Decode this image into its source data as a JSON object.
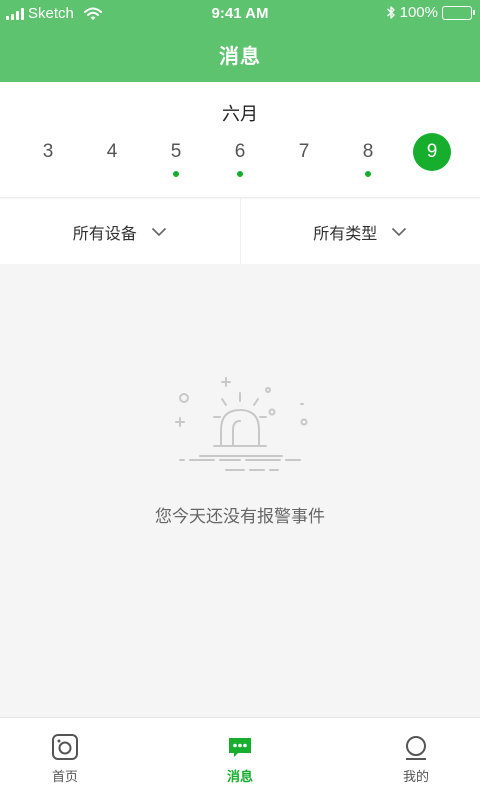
{
  "status_bar": {
    "carrier": "Sketch",
    "time": "9:41 AM",
    "battery": "100%"
  },
  "header": {
    "title": "消息"
  },
  "calendar": {
    "month": "六月",
    "days": [
      "3",
      "4",
      "5",
      "6",
      "7",
      "8",
      "9"
    ],
    "selected_day": "9",
    "days_with_alerts": [
      "5",
      "6",
      "8"
    ]
  },
  "filters": {
    "device": "所有设备",
    "type": "所有类型"
  },
  "empty_state": {
    "message": "您今天还没有报警事件",
    "icon": "alarm-light-icon"
  },
  "tabbar": {
    "home": {
      "label": "首页",
      "icon": "camera-icon"
    },
    "messages": {
      "label": "消息",
      "icon": "chat-bubble-icon"
    },
    "me": {
      "label": "我的",
      "icon": "user-icon"
    }
  },
  "colors": {
    "header": "#5ec36f",
    "accent": "#17ae2e",
    "background": "#f5f5f5"
  }
}
